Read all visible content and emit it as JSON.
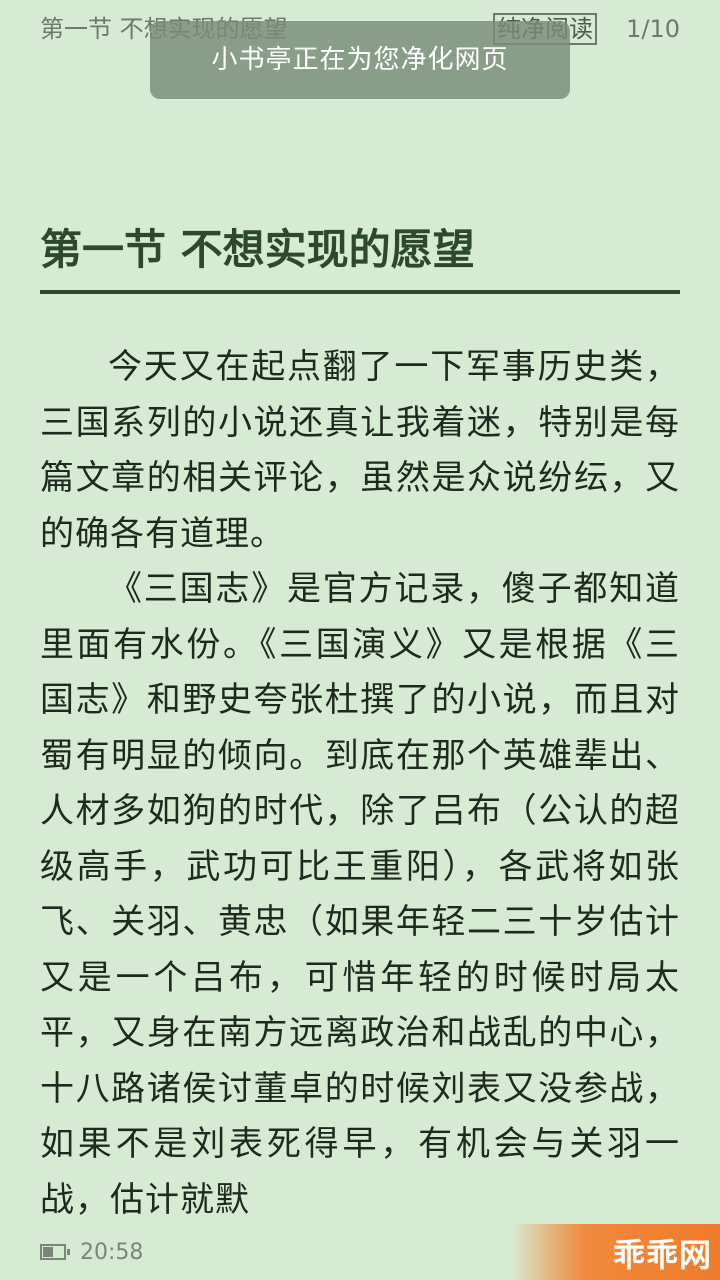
{
  "header": {
    "chapter_title": "第一节 不想实现的愿望",
    "pure_read_label": "纯净阅读",
    "page_indicator": "1/10"
  },
  "toast": {
    "message": "小书亭正在为您净化网页"
  },
  "article": {
    "title": "第一节 不想实现的愿望",
    "paragraphs": [
      "今天又在起点翻了一下军事历史类，三国系列的小说还真让我着迷，特别是每篇文章的相关评论，虽然是众说纷纭，又的确各有道理。",
      "《三国志》是官方记录，傻子都知道里面有水份。《三国演义》又是根据《三国志》和野史夸张杜撰了的小说，而且对蜀有明显的倾向。到底在那个英雄辈出、人材多如狗的时代，除了吕布（公认的超级高手，武功可比王重阳），各武将如张飞、关羽、黄忠（如果年轻二三十岁估计又是一个吕布，可惜年轻的时候时局太平，又身在南方远离政治和战乱的中心，十八路诸侯讨董卓的时候刘表又没参战，如果不是刘表死得早，有机会与关羽一战，估计就默"
    ]
  },
  "footer": {
    "battery_icon": "battery-icon",
    "time": "20:58"
  },
  "watermark": {
    "text": "乖乖网",
    "color": "#ef7b2a"
  }
}
